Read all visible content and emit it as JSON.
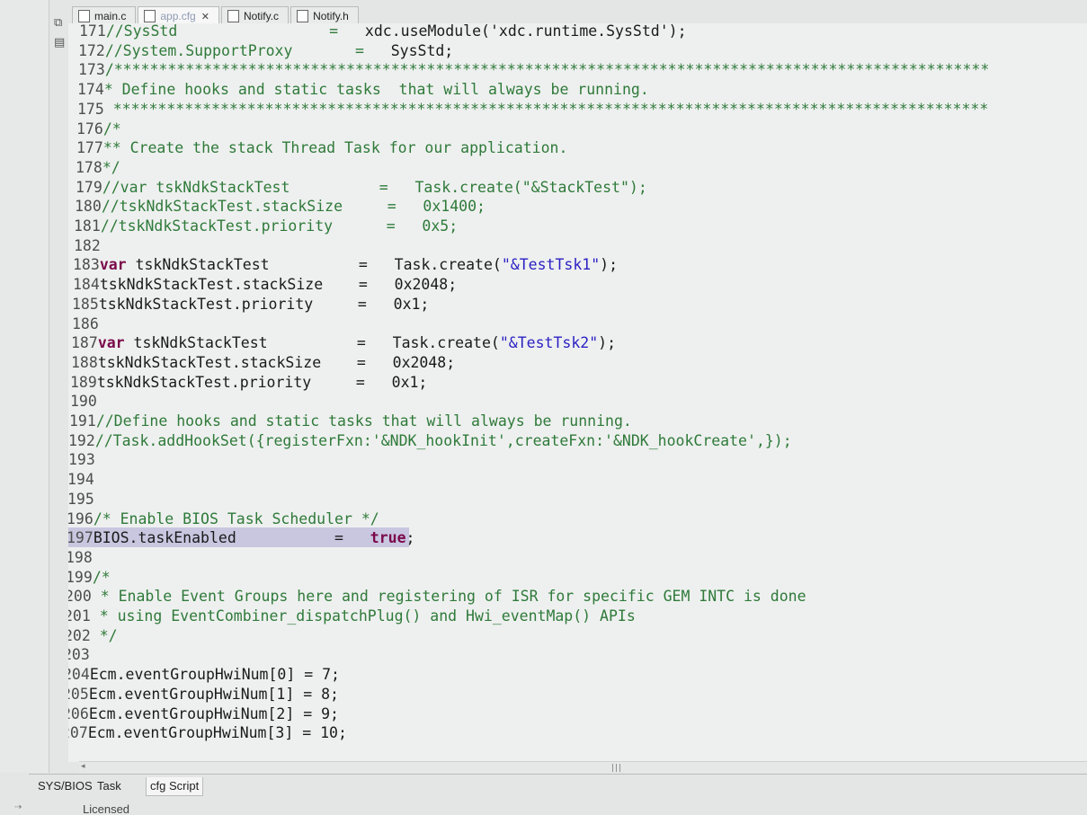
{
  "tabs": [
    {
      "label": "main.c",
      "icon": "c-file-icon",
      "active": false,
      "faded": false,
      "closable": false
    },
    {
      "label": "app.cfg",
      "icon": "cfg-file-icon",
      "active": true,
      "faded": true,
      "closable": true
    },
    {
      "label": "Notify.c",
      "icon": "c-file-icon",
      "active": false,
      "faded": false,
      "closable": false
    },
    {
      "label": "Notify.h",
      "icon": "h-file-icon",
      "active": false,
      "faded": false,
      "closable": false
    }
  ],
  "tab_close_glyph": "✕",
  "editor": {
    "lines": [
      {
        "n": "171",
        "segs": [
          [
            "cm",
            "//SysStd                 =   "
          ],
          [
            "",
            "xdc.useModule('xdc.runtime.SysStd');"
          ]
        ]
      },
      {
        "n": "172",
        "segs": [
          [
            "cm",
            "//System.SupportProxy       =   "
          ],
          [
            "",
            "SysStd;"
          ]
        ]
      },
      {
        "n": "173",
        "segs": [
          [
            "cm",
            "/**************************************************************************************************"
          ]
        ]
      },
      {
        "n": "174",
        "segs": [
          [
            "cm",
            "* Define hooks and static tasks  that will always be running."
          ]
        ]
      },
      {
        "n": "175",
        "segs": [
          [
            "cm",
            " **************************************************************************************************"
          ]
        ]
      },
      {
        "n": "176",
        "segs": [
          [
            "cm",
            "/*"
          ]
        ]
      },
      {
        "n": "177",
        "segs": [
          [
            "cm",
            "** Create the stack Thread Task for our application."
          ]
        ]
      },
      {
        "n": "178",
        "segs": [
          [
            "cm",
            "*/"
          ]
        ]
      },
      {
        "n": "179",
        "segs": [
          [
            "cm",
            "//var tskNdkStackTest          =   Task.create(\"&StackTest\");"
          ]
        ]
      },
      {
        "n": "180",
        "segs": [
          [
            "cm",
            "//tskNdkStackTest.stackSize     =   0x1400;"
          ]
        ]
      },
      {
        "n": "181",
        "segs": [
          [
            "cm",
            "//tskNdkStackTest.priority      =   0x5;"
          ]
        ]
      },
      {
        "n": "182",
        "segs": []
      },
      {
        "n": "183",
        "segs": [
          [
            "kw",
            "var"
          ],
          [
            "",
            " tskNdkStackTest          =   Task.create("
          ],
          [
            "str",
            "\"&TestTsk1\""
          ],
          [
            "",
            ");"
          ]
        ]
      },
      {
        "n": "184",
        "segs": [
          [
            "",
            "tskNdkStackTest.stackSize    =   0x2048;"
          ]
        ]
      },
      {
        "n": "185",
        "segs": [
          [
            "",
            "tskNdkStackTest.priority     =   0x1;"
          ]
        ]
      },
      {
        "n": "186",
        "segs": []
      },
      {
        "n": "187",
        "segs": [
          [
            "kw",
            "var"
          ],
          [
            "",
            " tskNdkStackTest          =   Task.create("
          ],
          [
            "str",
            "\"&TestTsk2\""
          ],
          [
            "",
            ");"
          ]
        ]
      },
      {
        "n": "188",
        "segs": [
          [
            "",
            "tskNdkStackTest.stackSize    =   0x2048;"
          ]
        ]
      },
      {
        "n": "189",
        "segs": [
          [
            "",
            "tskNdkStackTest.priority     =   0x1;"
          ]
        ]
      },
      {
        "n": "190",
        "segs": []
      },
      {
        "n": "191",
        "segs": [
          [
            "cm",
            "//Define hooks and static tasks that will always be running."
          ]
        ]
      },
      {
        "n": "192",
        "segs": [
          [
            "cm",
            "//Task.addHookSet({registerFxn:'&NDK_hookInit',createFxn:'&NDK_hookCreate',});"
          ]
        ]
      },
      {
        "n": "193",
        "segs": []
      },
      {
        "n": "194",
        "segs": []
      },
      {
        "n": "195",
        "segs": []
      },
      {
        "n": "196",
        "segs": [
          [
            "cm",
            "/* Enable BIOS Task Scheduler */"
          ]
        ]
      },
      {
        "n": "197",
        "segs": [
          [
            "",
            "BIOS.taskEnabled           =   "
          ],
          [
            "kw",
            "true"
          ],
          [
            "",
            ";"
          ]
        ]
      },
      {
        "n": "198",
        "segs": []
      },
      {
        "n": "199",
        "segs": [
          [
            "cm",
            "/*"
          ]
        ]
      },
      {
        "n": "200",
        "segs": [
          [
            "cm",
            " * Enable Event Groups here and registering of ISR for specific GEM INTC is done"
          ]
        ]
      },
      {
        "n": "201",
        "segs": [
          [
            "cm",
            " * using EventCombiner_dispatchPlug() and Hwi_eventMap() APIs"
          ]
        ]
      },
      {
        "n": "202",
        "segs": [
          [
            "cm",
            " */"
          ]
        ]
      },
      {
        "n": "203",
        "segs": []
      },
      {
        "n": "204",
        "segs": [
          [
            "",
            "Ecm.eventGroupHwiNum[0] = 7;"
          ]
        ]
      },
      {
        "n": "205",
        "segs": [
          [
            "",
            "Ecm.eventGroupHwiNum[1] = 8;"
          ]
        ]
      },
      {
        "n": "206",
        "segs": [
          [
            "",
            "Ecm.eventGroupHwiNum[2] = 9;"
          ]
        ]
      },
      {
        "n": "207",
        "segs": [
          [
            "",
            "Ecm.eventGroupHwiNum[3] = 10;"
          ]
        ]
      }
    ]
  },
  "scrollbar_grip": "|||",
  "bottom_tabs": [
    {
      "label": "SYS/BIOS",
      "active": false
    },
    {
      "label": "Task",
      "active": false
    },
    {
      "label": "cfg Script",
      "active": true
    }
  ],
  "status_text": "Licensed"
}
